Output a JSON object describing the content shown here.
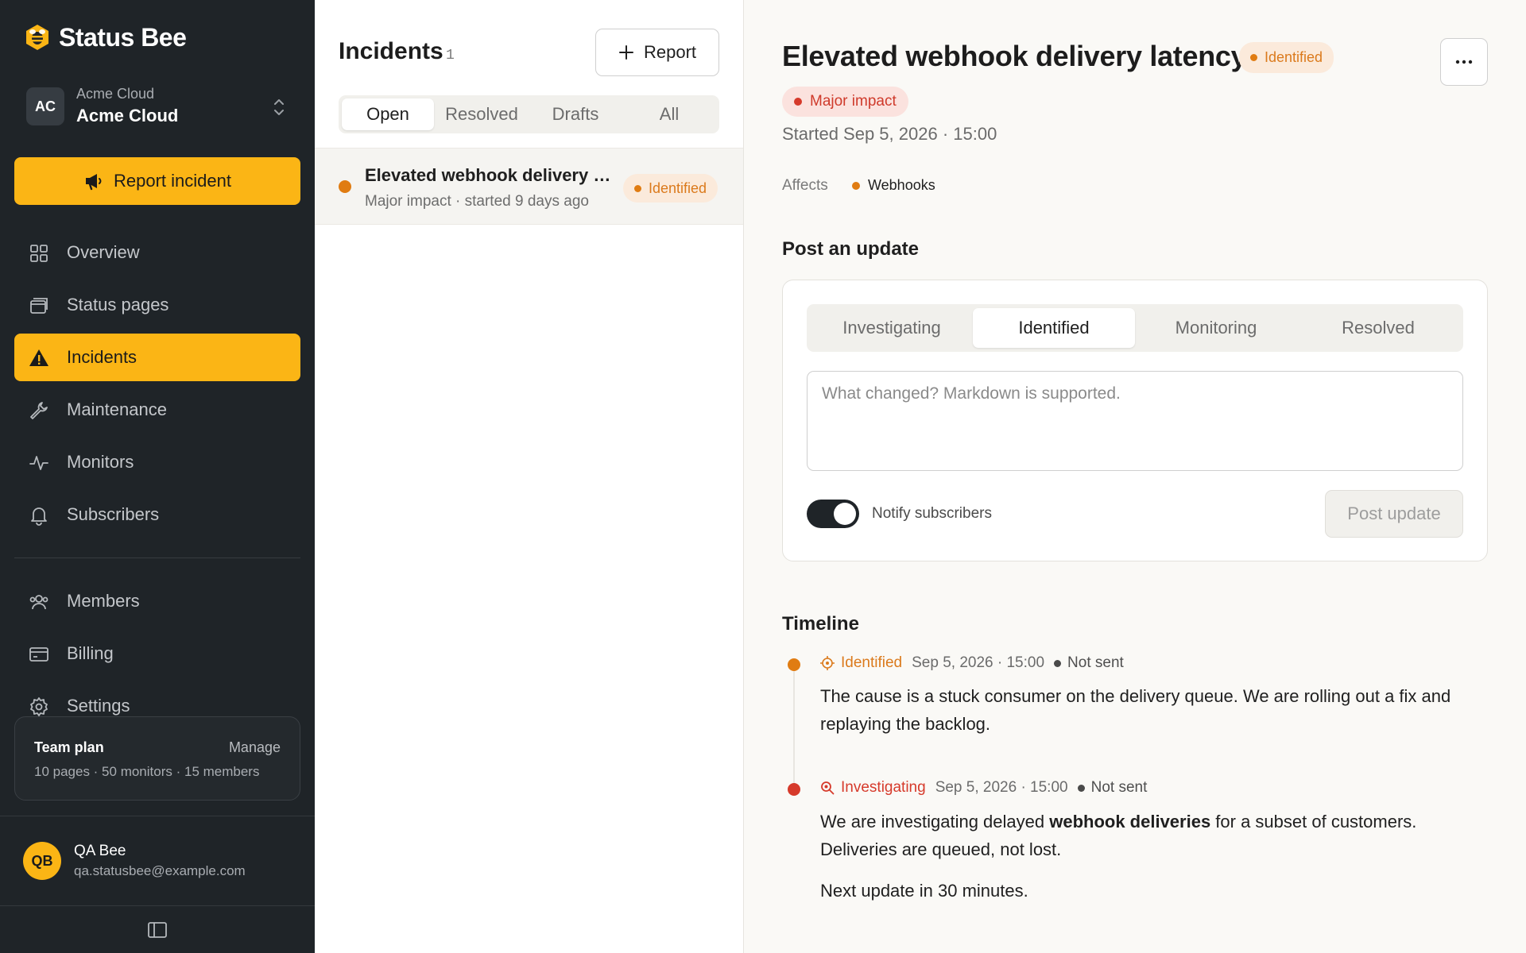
{
  "brand": {
    "name": "Status Bee",
    "accent": "#fbb515"
  },
  "org": {
    "initials": "AC",
    "subtitle": "Acme Cloud",
    "name": "Acme Cloud"
  },
  "sidebar": {
    "report_label": "Report incident",
    "items": [
      {
        "label": "Overview",
        "icon": "grid-icon"
      },
      {
        "label": "Status pages",
        "icon": "browser-icon"
      },
      {
        "label": "Incidents",
        "icon": "warning-icon",
        "active": true
      },
      {
        "label": "Maintenance",
        "icon": "wrench-icon"
      },
      {
        "label": "Monitors",
        "icon": "activity-icon"
      },
      {
        "label": "Subscribers",
        "icon": "bell-icon"
      },
      {
        "label": "Members",
        "icon": "users-icon"
      },
      {
        "label": "Billing",
        "icon": "credit-card-icon"
      },
      {
        "label": "Settings",
        "icon": "gear-icon"
      }
    ],
    "plan": {
      "name": "Team plan",
      "manage": "Manage",
      "meta": "10 pages · 50 monitors · 15 members"
    },
    "user": {
      "initials": "QB",
      "name": "QA Bee",
      "email": "qa.statusbee@example.com"
    }
  },
  "list": {
    "title": "Incidents",
    "count": "1",
    "new_label": "Report",
    "tabs": [
      "Open",
      "Resolved",
      "Drafts",
      "All"
    ],
    "active_tab": "Open",
    "rows": [
      {
        "title": "Elevated webhook delivery latency",
        "subtitle": "Major impact · started 9 days ago",
        "status": "Identified"
      }
    ]
  },
  "detail": {
    "title": "Elevated webhook delivery latency",
    "status": "Identified",
    "impact": "Major impact",
    "started": "Started Sep 5, 2026 · 15:00",
    "affects_label": "Affects",
    "component": "Webhooks",
    "post_heading": "Post an update",
    "status_options": [
      "Investigating",
      "Identified",
      "Monitoring",
      "Resolved"
    ],
    "selected_status": "Identified",
    "textarea_placeholder": "What changed? Markdown is supported.",
    "textarea_value": "",
    "notify_label": "Notify subscribers",
    "notify_on": true,
    "post_label": "Post update",
    "timeline_heading": "Timeline",
    "timeline": [
      {
        "status": "Identified",
        "time": "Sep 5, 2026 · 15:00",
        "delivery": "Not sent",
        "body": "The cause is a stuck consumer on the delivery queue. We are rolling out a fix and replaying the backlog."
      },
      {
        "status": "Investigating",
        "time": "Sep 5, 2026 · 15:00",
        "delivery": "Not sent",
        "body_pre": "We are investigating delayed ",
        "body_bold": "webhook deliveries",
        "body_post": " for a subset of customers. Deliveries are queued, not lost.",
        "body2": "Next update in 30 minutes."
      }
    ]
  },
  "colors": {
    "identified": "#e07c12",
    "investigating": "#d63a2b",
    "sidebar_bg": "#1f2428"
  }
}
